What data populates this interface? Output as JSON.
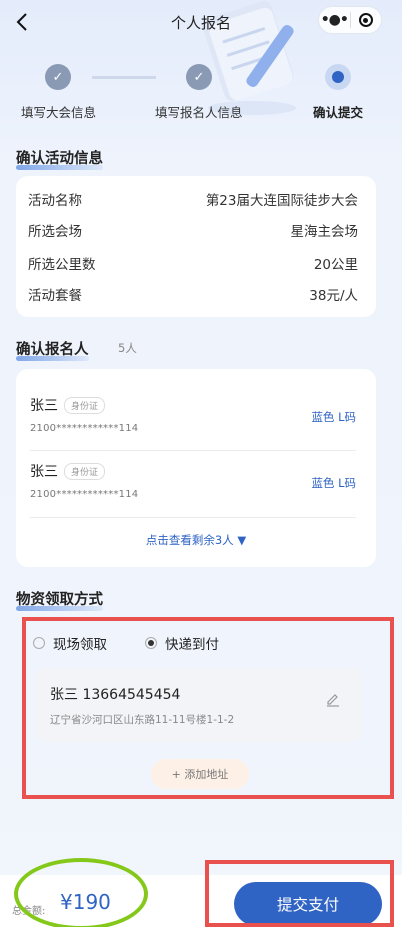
{
  "header": {
    "title": "个人报名",
    "back_icon": "chevron-left-icon",
    "more_icon": "more-dots-icon",
    "close_icon": "target-circle-icon"
  },
  "steps": [
    {
      "label": "填写大会信息",
      "state": "done"
    },
    {
      "label": "填写报名人信息",
      "state": "done"
    },
    {
      "label": "确认提交",
      "state": "active"
    }
  ],
  "activity": {
    "section_title": "确认活动信息",
    "rows": [
      {
        "label": "活动名称",
        "value": "第23届大连国际徒步大会"
      },
      {
        "label": "所选会场",
        "value": "星海主会场"
      },
      {
        "label": "所选公里数",
        "value": "20公里"
      },
      {
        "label": "活动套餐",
        "value": "38元/人"
      }
    ]
  },
  "registrants": {
    "section_title": "确认报名人",
    "count": "5人",
    "people": [
      {
        "name": "张三",
        "id_type": "身份证",
        "id_no": "2100************114",
        "spec": "蓝色  L码"
      },
      {
        "name": "张三",
        "id_type": "身份证",
        "id_no": "2100************114",
        "spec": "蓝色  L码"
      }
    ],
    "more_text": "点击查看剩余3人"
  },
  "delivery": {
    "section_title": "物资领取方式",
    "options": [
      {
        "label": "现场领取",
        "checked": false
      },
      {
        "label": "快递到付",
        "checked": true
      }
    ],
    "address": {
      "contact": "张三  13664545454",
      "addr": "辽宁省沙河口区山东路11-11号楼1-1-2"
    },
    "add_address": "+ 添加地址"
  },
  "footer": {
    "total_label": "总金额:",
    "total_amount": "¥190",
    "pay_label": "提交支付"
  },
  "colors": {
    "accent": "#2f63c4",
    "highlight_red": "#e9514f",
    "highlight_green": "#84c91a"
  }
}
